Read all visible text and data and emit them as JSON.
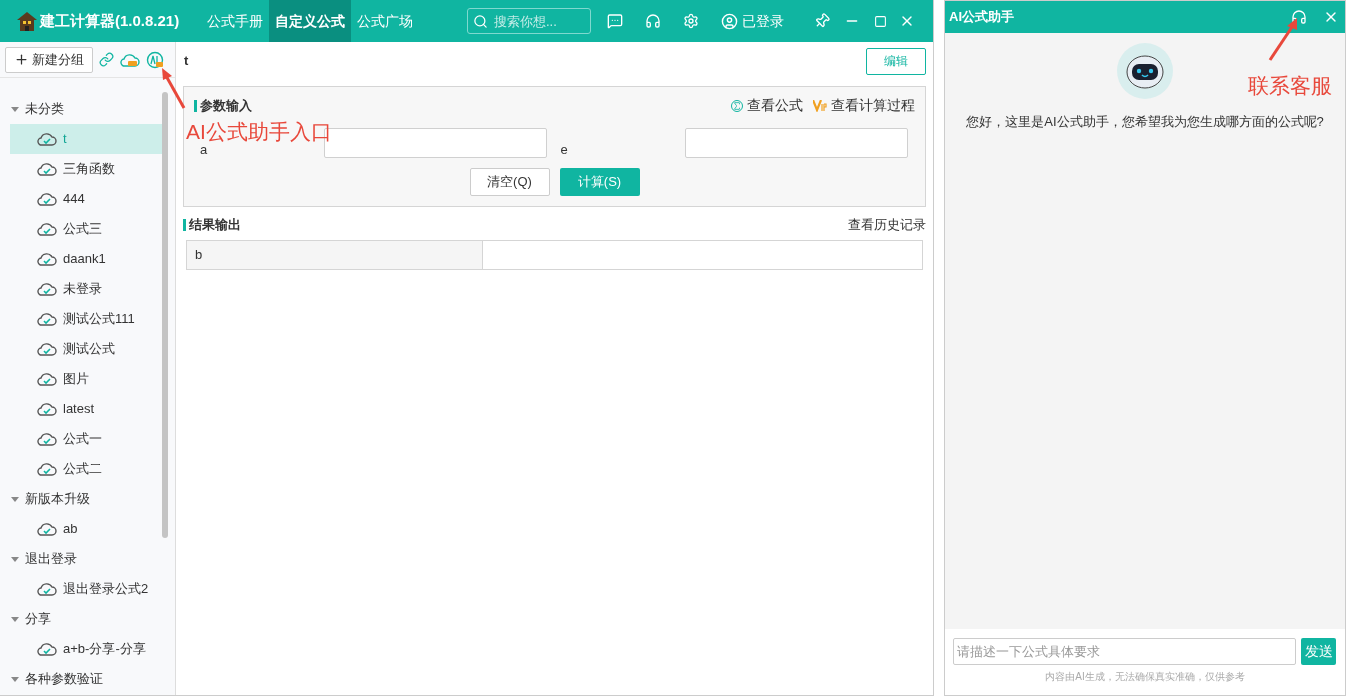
{
  "app": {
    "title": "建工计算器(1.0.8.21)",
    "tabs": [
      {
        "label": "公式手册",
        "selected": false
      },
      {
        "label": "自定义公式",
        "selected": true
      },
      {
        "label": "公式广场",
        "selected": false
      }
    ],
    "search": {
      "placeholder": "搜索你想..."
    },
    "account": "已登录"
  },
  "sidebar": {
    "new_group": "新建分组",
    "groups": [
      {
        "label": "未分类",
        "expanded": true,
        "children": [
          {
            "label": "t",
            "selected": true
          },
          {
            "label": "三角函数",
            "selected": false
          },
          {
            "label": "444",
            "selected": false
          },
          {
            "label": "公式三",
            "selected": false
          },
          {
            "label": "daank1",
            "selected": false
          },
          {
            "label": "未登录",
            "selected": false
          },
          {
            "label": "测试公式111",
            "selected": false
          },
          {
            "label": "测试公式",
            "selected": false
          },
          {
            "label": "图片",
            "selected": false
          },
          {
            "label": "latest",
            "selected": false
          },
          {
            "label": "公式一",
            "selected": false
          },
          {
            "label": "公式二",
            "selected": false
          }
        ]
      },
      {
        "label": "新版本升级",
        "expanded": true,
        "children": [
          {
            "label": "ab",
            "selected": false
          }
        ]
      },
      {
        "label": "退出登录",
        "expanded": true,
        "children": [
          {
            "label": "退出登录公式2",
            "selected": false
          }
        ]
      },
      {
        "label": "分享",
        "expanded": true,
        "children": [
          {
            "label": "a+b-分享-分享",
            "selected": false
          }
        ]
      },
      {
        "label": "各种参数验证",
        "expanded": true
      }
    ]
  },
  "formula": {
    "title": "t",
    "edit": "编辑",
    "params": {
      "title": "参数输入",
      "view_formula": "查看公式",
      "view_process": "查看计算过程",
      "fields": [
        {
          "label": "a"
        },
        {
          "label": "e"
        }
      ],
      "clear": "清空(Q)",
      "calculate": "计算(S)"
    },
    "results": {
      "title": "结果输出",
      "history": "查看历史记录",
      "rows": [
        {
          "label": "b"
        }
      ]
    }
  },
  "assistant": {
    "title": "AI公式助手",
    "greeting": "您好，这里是AI公式助手，您希望我为您生成哪方面的公式呢?",
    "input": {
      "placeholder": "请描述一下公式具体要求"
    },
    "send": "发送",
    "disclaimer": "内容由AI生成，无法确保真实准确，仅供参考"
  },
  "annotations": [
    {
      "text": "AI公式助手入口"
    },
    {
      "text": "联系客服"
    }
  ]
}
